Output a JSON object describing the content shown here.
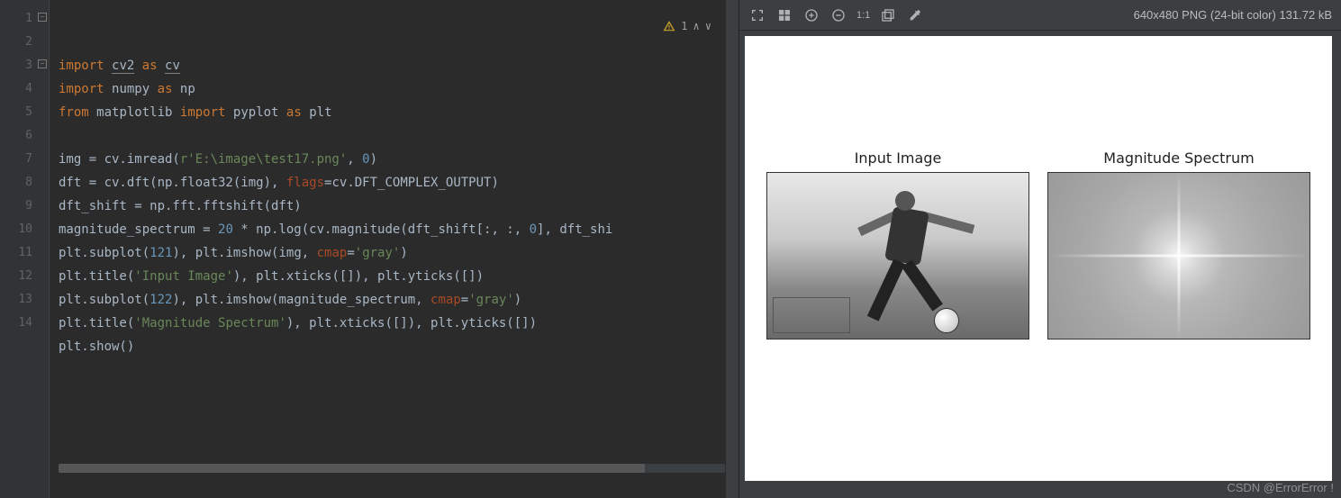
{
  "editor": {
    "inspection": {
      "warning_count": "1"
    },
    "lines": [
      {
        "n": "1",
        "tokens": [
          {
            "t": "import",
            "c": "kw"
          },
          {
            "t": " "
          },
          {
            "t": "cv2",
            "c": "ident underline"
          },
          {
            "t": " "
          },
          {
            "t": "as",
            "c": "kw"
          },
          {
            "t": " "
          },
          {
            "t": "cv",
            "c": "ident underline"
          }
        ],
        "fold": true
      },
      {
        "n": "2",
        "tokens": [
          {
            "t": "import",
            "c": "kw"
          },
          {
            "t": " "
          },
          {
            "t": "numpy",
            "c": "ident"
          },
          {
            "t": " "
          },
          {
            "t": "as",
            "c": "kw"
          },
          {
            "t": " "
          },
          {
            "t": "np",
            "c": "ident"
          }
        ]
      },
      {
        "n": "3",
        "tokens": [
          {
            "t": "from",
            "c": "kw"
          },
          {
            "t": " "
          },
          {
            "t": "matplotlib",
            "c": "ident"
          },
          {
            "t": " "
          },
          {
            "t": "import",
            "c": "kw"
          },
          {
            "t": " "
          },
          {
            "t": "pyplot",
            "c": "ident"
          },
          {
            "t": " "
          },
          {
            "t": "as",
            "c": "kw"
          },
          {
            "t": " "
          },
          {
            "t": "plt",
            "c": "ident"
          }
        ],
        "fold": true
      },
      {
        "n": "4",
        "tokens": []
      },
      {
        "n": "5",
        "tokens": [
          {
            "t": "img = cv.imread("
          },
          {
            "t": "r'E:\\image\\test17.png'",
            "c": "str"
          },
          {
            "t": ", "
          },
          {
            "t": "0",
            "c": "num"
          },
          {
            "t": ")"
          }
        ]
      },
      {
        "n": "6",
        "tokens": [
          {
            "t": "dft = cv.dft(np.float32(img), "
          },
          {
            "t": "flags",
            "c": "param"
          },
          {
            "t": "=cv.DFT_COMPLEX_OUTPUT)"
          }
        ]
      },
      {
        "n": "7",
        "tokens": [
          {
            "t": "dft_shift = np.fft.fftshift(dft)"
          }
        ]
      },
      {
        "n": "8",
        "tokens": [
          {
            "t": "magnitude_spectrum = "
          },
          {
            "t": "20",
            "c": "num"
          },
          {
            "t": " * np.log(cv.magnitude(dft_shift[:, :, "
          },
          {
            "t": "0",
            "c": "num"
          },
          {
            "t": "], dft_shi"
          }
        ]
      },
      {
        "n": "9",
        "tokens": [
          {
            "t": "plt.subplot("
          },
          {
            "t": "121",
            "c": "num"
          },
          {
            "t": "), plt.imshow(img, "
          },
          {
            "t": "cmap",
            "c": "param"
          },
          {
            "t": "="
          },
          {
            "t": "'gray'",
            "c": "str"
          },
          {
            "t": ")"
          }
        ]
      },
      {
        "n": "10",
        "tokens": [
          {
            "t": "plt.title("
          },
          {
            "t": "'Input Image'",
            "c": "str"
          },
          {
            "t": "), plt.xticks([]), plt.yticks([])"
          }
        ]
      },
      {
        "n": "11",
        "tokens": [
          {
            "t": "plt.subplot("
          },
          {
            "t": "122",
            "c": "num"
          },
          {
            "t": "), plt.imshow(magnitude_spectrum, "
          },
          {
            "t": "cmap",
            "c": "param"
          },
          {
            "t": "="
          },
          {
            "t": "'gray'",
            "c": "str"
          },
          {
            "t": ")"
          }
        ]
      },
      {
        "n": "12",
        "tokens": [
          {
            "t": "plt.title("
          },
          {
            "t": "'Magnitude Spectrum'",
            "c": "str"
          },
          {
            "t": "), plt.xticks([]), plt.yticks([])"
          }
        ]
      },
      {
        "n": "13",
        "tokens": [
          {
            "t": "plt.show()"
          }
        ]
      },
      {
        "n": "14",
        "tokens": []
      }
    ]
  },
  "preview": {
    "toolbar": {
      "zoom_label": "1:1"
    },
    "image_info": "640x480 PNG (24-bit color) 131.72 kB",
    "subplot1_title": "Input Image",
    "subplot2_title": "Magnitude Spectrum"
  },
  "watermark": "CSDN @ErrorError !"
}
